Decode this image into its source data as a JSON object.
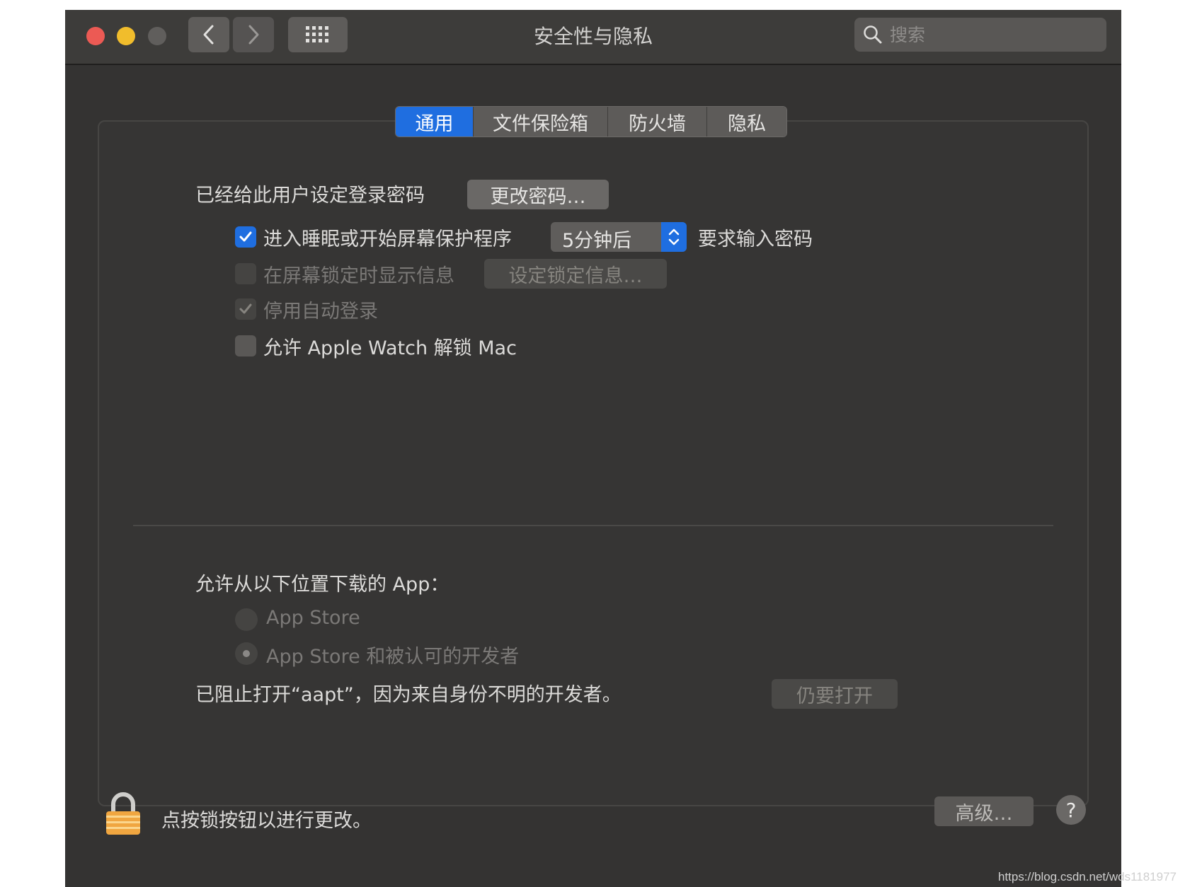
{
  "window": {
    "title": "安全性与隐私",
    "search_placeholder": "搜索"
  },
  "tabs": [
    {
      "label": "通用",
      "active": true
    },
    {
      "label": "文件保险箱",
      "active": false
    },
    {
      "label": "防火墙",
      "active": false
    },
    {
      "label": "隐私",
      "active": false
    }
  ],
  "general": {
    "password_set_label": "已经给此用户设定登录密码",
    "change_password_button": "更改密码…",
    "require_password_checkbox_label": "进入睡眠或开始屏幕保护程序",
    "require_password_checked": true,
    "require_password_delay": "5分钟后",
    "require_password_suffix": "要求输入密码",
    "show_message_label": "在屏幕锁定时显示信息",
    "show_message_checked": false,
    "set_lock_message_button": "设定锁定信息…",
    "disable_auto_login_label": "停用自动登录",
    "disable_auto_login_checked": true,
    "apple_watch_label": "允许 Apple Watch 解锁 Mac",
    "apple_watch_checked": false
  },
  "downloads": {
    "heading": "允许从以下位置下载的 App：",
    "options": [
      {
        "label": "App Store",
        "selected": false
      },
      {
        "label": "App Store 和被认可的开发者",
        "selected": true
      }
    ],
    "blocked_message": "已阻止打开“aapt”，因为来自身份不明的开发者。",
    "open_anyway_button": "仍要打开"
  },
  "footer": {
    "lock_message": "点按锁按钮以进行更改。",
    "advanced_button": "高级…",
    "help_button": "?"
  },
  "watermark": "https://blog.csdn.net/wds1181977",
  "colors": {
    "accent": "#1f6ee0",
    "background": "#343332",
    "text": "#dcdbd9"
  }
}
